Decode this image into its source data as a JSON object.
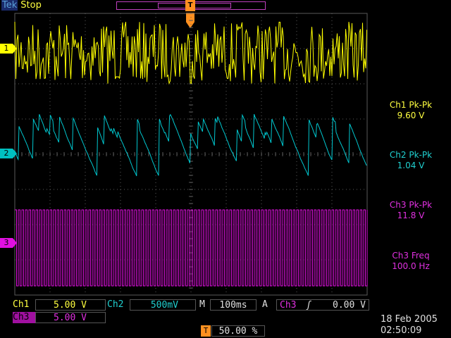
{
  "header": {
    "brand": "Tek",
    "run_state": "Stop",
    "trigger_marker_label": "T",
    "trigger_marker_glyph": "⮡"
  },
  "channels": [
    {
      "id": "1",
      "label": "1",
      "color": "#ffff00"
    },
    {
      "id": "2",
      "label": "2",
      "color": "#00c8d0"
    },
    {
      "id": "3",
      "label": "3",
      "color": "#e010e0"
    }
  ],
  "measurements": [
    {
      "title": "Ch1 Pk-Pk",
      "value": "9.60 V",
      "color": "#ffff40"
    },
    {
      "title": "Ch2 Pk-Pk",
      "value": "1.04 V",
      "color": "#20d0d0"
    },
    {
      "title": "Ch3 Pk-Pk",
      "value": "11.8 V",
      "color": "#e030e0"
    },
    {
      "title": "Ch3 Freq",
      "value": "100.0 Hz",
      "color": "#e030e0"
    }
  ],
  "status": {
    "ch1_label": "Ch1",
    "ch1_scale": "5.00 V",
    "ch2_label": "Ch2",
    "ch2_scale": "500mV",
    "time_label": "M",
    "time_scale": "100ms",
    "trig_label": "A",
    "trig_source": "Ch3",
    "trig_slope": "ʃ",
    "trig_level": "0.00 V",
    "ch3_label": "Ch3",
    "ch3_scale": "5.00 V",
    "trig_pos_label": "T",
    "trig_pos_value": "50.00 %"
  },
  "datetime": {
    "date": "18 Feb  2005",
    "time": "02:50:09"
  },
  "colors": {
    "grid": "#5a5a5a",
    "ch1": "#ffff00",
    "ch2": "#00c8d0",
    "ch3": "#e010e0",
    "ch3_label_bg": "#a010a0"
  }
}
